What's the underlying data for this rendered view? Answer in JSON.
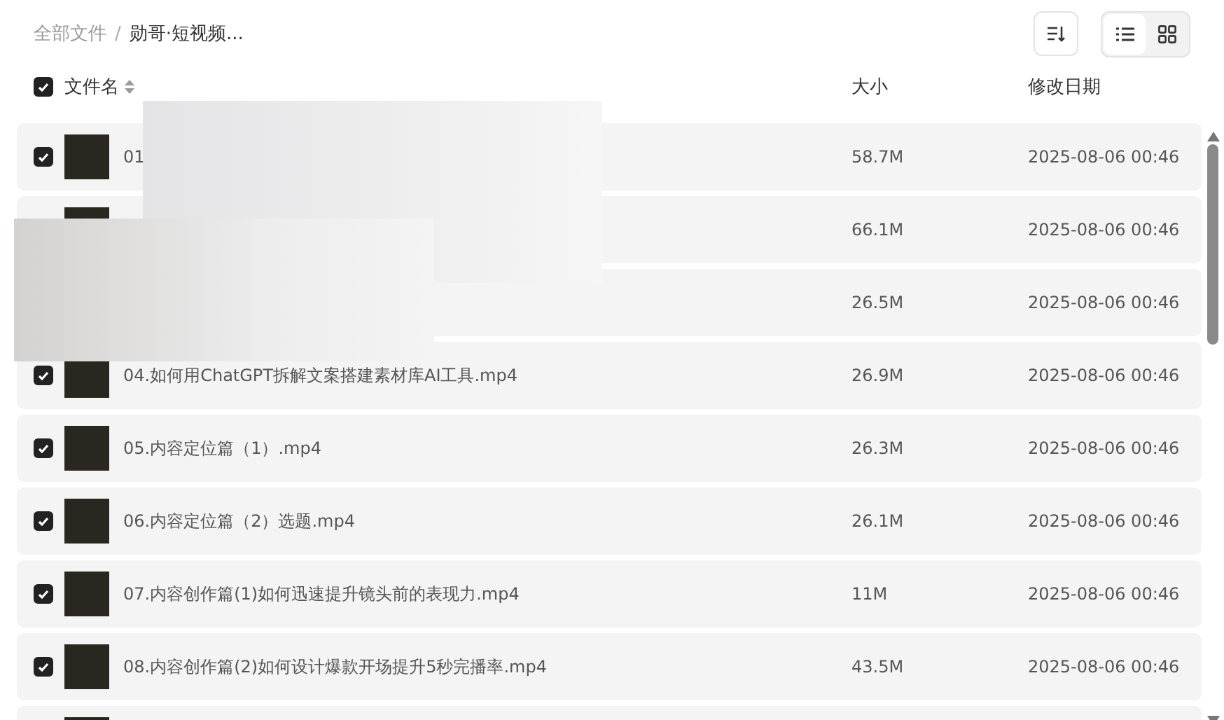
{
  "breadcrumb": [
    {
      "label": "全部文件",
      "current": false
    },
    {
      "label": "勋哥·短视频...",
      "current": true
    }
  ],
  "breadcrumb_separator": "/",
  "view_buttons": [
    {
      "kind": "list",
      "selected": true
    },
    {
      "kind": "grid",
      "selected": false
    }
  ],
  "header": {
    "checked": true,
    "name": "文件名",
    "size": "大小",
    "date": "修改日期"
  },
  "rows": [
    {
      "checked": true,
      "name": "01",
      "size": "58.7M",
      "date": "2025-08-06 00:46"
    },
    {
      "size": "66.1M",
      "date": "2025-08-06 00:46"
    },
    {
      "size": "26.5M",
      "date": "2025-08-06 00:46"
    },
    {
      "checked": true,
      "name": "04.如何用ChatGPT拆解文案搭建素材库AI工具.mp4",
      "size": "26.9M",
      "date": "2025-08-06 00:46"
    },
    {
      "checked": true,
      "name": "05.内容定位篇（1）.mp4",
      "size": "26.3M",
      "date": "2025-08-06 00:46"
    },
    {
      "checked": true,
      "name": "06.内容定位篇（2）选题.mp4",
      "size": "26.1M",
      "date": "2025-08-06 00:46"
    },
    {
      "checked": true,
      "name": "07.内容创作篇(1)如何迅速提升镜头前的表现力.mp4",
      "size": "11M",
      "date": "2025-08-06 00:46"
    },
    {
      "checked": true,
      "name": "08.内容创作篇(2)如何设计爆款开场提升5秒完播率.mp4",
      "size": "43.5M",
      "date": "2025-08-06 00:46"
    },
    {}
  ]
}
